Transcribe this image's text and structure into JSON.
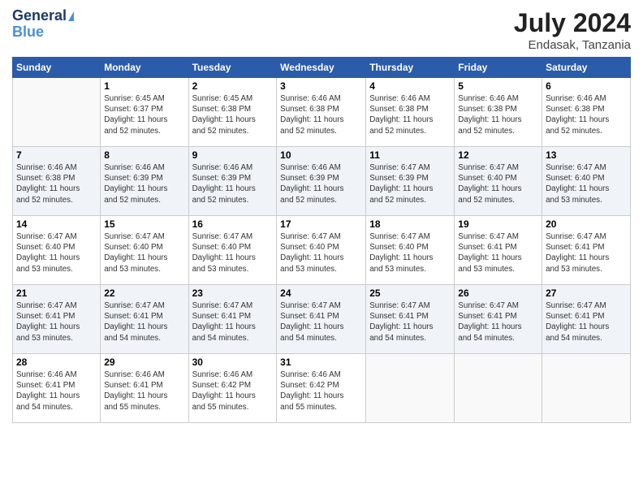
{
  "logo": {
    "line1": "General",
    "line2": "Blue"
  },
  "title": "July 2024",
  "subtitle": "Endasak, Tanzania",
  "weekdays": [
    "Sunday",
    "Monday",
    "Tuesday",
    "Wednesday",
    "Thursday",
    "Friday",
    "Saturday"
  ],
  "weeks": [
    [
      {
        "day": "",
        "info": ""
      },
      {
        "day": "1",
        "info": "Sunrise: 6:45 AM\nSunset: 6:37 PM\nDaylight: 11 hours\nand 52 minutes."
      },
      {
        "day": "2",
        "info": "Sunrise: 6:45 AM\nSunset: 6:38 PM\nDaylight: 11 hours\nand 52 minutes."
      },
      {
        "day": "3",
        "info": "Sunrise: 6:46 AM\nSunset: 6:38 PM\nDaylight: 11 hours\nand 52 minutes."
      },
      {
        "day": "4",
        "info": "Sunrise: 6:46 AM\nSunset: 6:38 PM\nDaylight: 11 hours\nand 52 minutes."
      },
      {
        "day": "5",
        "info": "Sunrise: 6:46 AM\nSunset: 6:38 PM\nDaylight: 11 hours\nand 52 minutes."
      },
      {
        "day": "6",
        "info": "Sunrise: 6:46 AM\nSunset: 6:38 PM\nDaylight: 11 hours\nand 52 minutes."
      }
    ],
    [
      {
        "day": "7",
        "info": "Sunrise: 6:46 AM\nSunset: 6:38 PM\nDaylight: 11 hours\nand 52 minutes."
      },
      {
        "day": "8",
        "info": "Sunrise: 6:46 AM\nSunset: 6:39 PM\nDaylight: 11 hours\nand 52 minutes."
      },
      {
        "day": "9",
        "info": "Sunrise: 6:46 AM\nSunset: 6:39 PM\nDaylight: 11 hours\nand 52 minutes."
      },
      {
        "day": "10",
        "info": "Sunrise: 6:46 AM\nSunset: 6:39 PM\nDaylight: 11 hours\nand 52 minutes."
      },
      {
        "day": "11",
        "info": "Sunrise: 6:47 AM\nSunset: 6:39 PM\nDaylight: 11 hours\nand 52 minutes."
      },
      {
        "day": "12",
        "info": "Sunrise: 6:47 AM\nSunset: 6:40 PM\nDaylight: 11 hours\nand 52 minutes."
      },
      {
        "day": "13",
        "info": "Sunrise: 6:47 AM\nSunset: 6:40 PM\nDaylight: 11 hours\nand 53 minutes."
      }
    ],
    [
      {
        "day": "14",
        "info": "Sunrise: 6:47 AM\nSunset: 6:40 PM\nDaylight: 11 hours\nand 53 minutes."
      },
      {
        "day": "15",
        "info": "Sunrise: 6:47 AM\nSunset: 6:40 PM\nDaylight: 11 hours\nand 53 minutes."
      },
      {
        "day": "16",
        "info": "Sunrise: 6:47 AM\nSunset: 6:40 PM\nDaylight: 11 hours\nand 53 minutes."
      },
      {
        "day": "17",
        "info": "Sunrise: 6:47 AM\nSunset: 6:40 PM\nDaylight: 11 hours\nand 53 minutes."
      },
      {
        "day": "18",
        "info": "Sunrise: 6:47 AM\nSunset: 6:40 PM\nDaylight: 11 hours\nand 53 minutes."
      },
      {
        "day": "19",
        "info": "Sunrise: 6:47 AM\nSunset: 6:41 PM\nDaylight: 11 hours\nand 53 minutes."
      },
      {
        "day": "20",
        "info": "Sunrise: 6:47 AM\nSunset: 6:41 PM\nDaylight: 11 hours\nand 53 minutes."
      }
    ],
    [
      {
        "day": "21",
        "info": "Sunrise: 6:47 AM\nSunset: 6:41 PM\nDaylight: 11 hours\nand 53 minutes."
      },
      {
        "day": "22",
        "info": "Sunrise: 6:47 AM\nSunset: 6:41 PM\nDaylight: 11 hours\nand 54 minutes."
      },
      {
        "day": "23",
        "info": "Sunrise: 6:47 AM\nSunset: 6:41 PM\nDaylight: 11 hours\nand 54 minutes."
      },
      {
        "day": "24",
        "info": "Sunrise: 6:47 AM\nSunset: 6:41 PM\nDaylight: 11 hours\nand 54 minutes."
      },
      {
        "day": "25",
        "info": "Sunrise: 6:47 AM\nSunset: 6:41 PM\nDaylight: 11 hours\nand 54 minutes."
      },
      {
        "day": "26",
        "info": "Sunrise: 6:47 AM\nSunset: 6:41 PM\nDaylight: 11 hours\nand 54 minutes."
      },
      {
        "day": "27",
        "info": "Sunrise: 6:47 AM\nSunset: 6:41 PM\nDaylight: 11 hours\nand 54 minutes."
      }
    ],
    [
      {
        "day": "28",
        "info": "Sunrise: 6:46 AM\nSunset: 6:41 PM\nDaylight: 11 hours\nand 54 minutes."
      },
      {
        "day": "29",
        "info": "Sunrise: 6:46 AM\nSunset: 6:41 PM\nDaylight: 11 hours\nand 55 minutes."
      },
      {
        "day": "30",
        "info": "Sunrise: 6:46 AM\nSunset: 6:42 PM\nDaylight: 11 hours\nand 55 minutes."
      },
      {
        "day": "31",
        "info": "Sunrise: 6:46 AM\nSunset: 6:42 PM\nDaylight: 11 hours\nand 55 minutes."
      },
      {
        "day": "",
        "info": ""
      },
      {
        "day": "",
        "info": ""
      },
      {
        "day": "",
        "info": ""
      }
    ]
  ]
}
